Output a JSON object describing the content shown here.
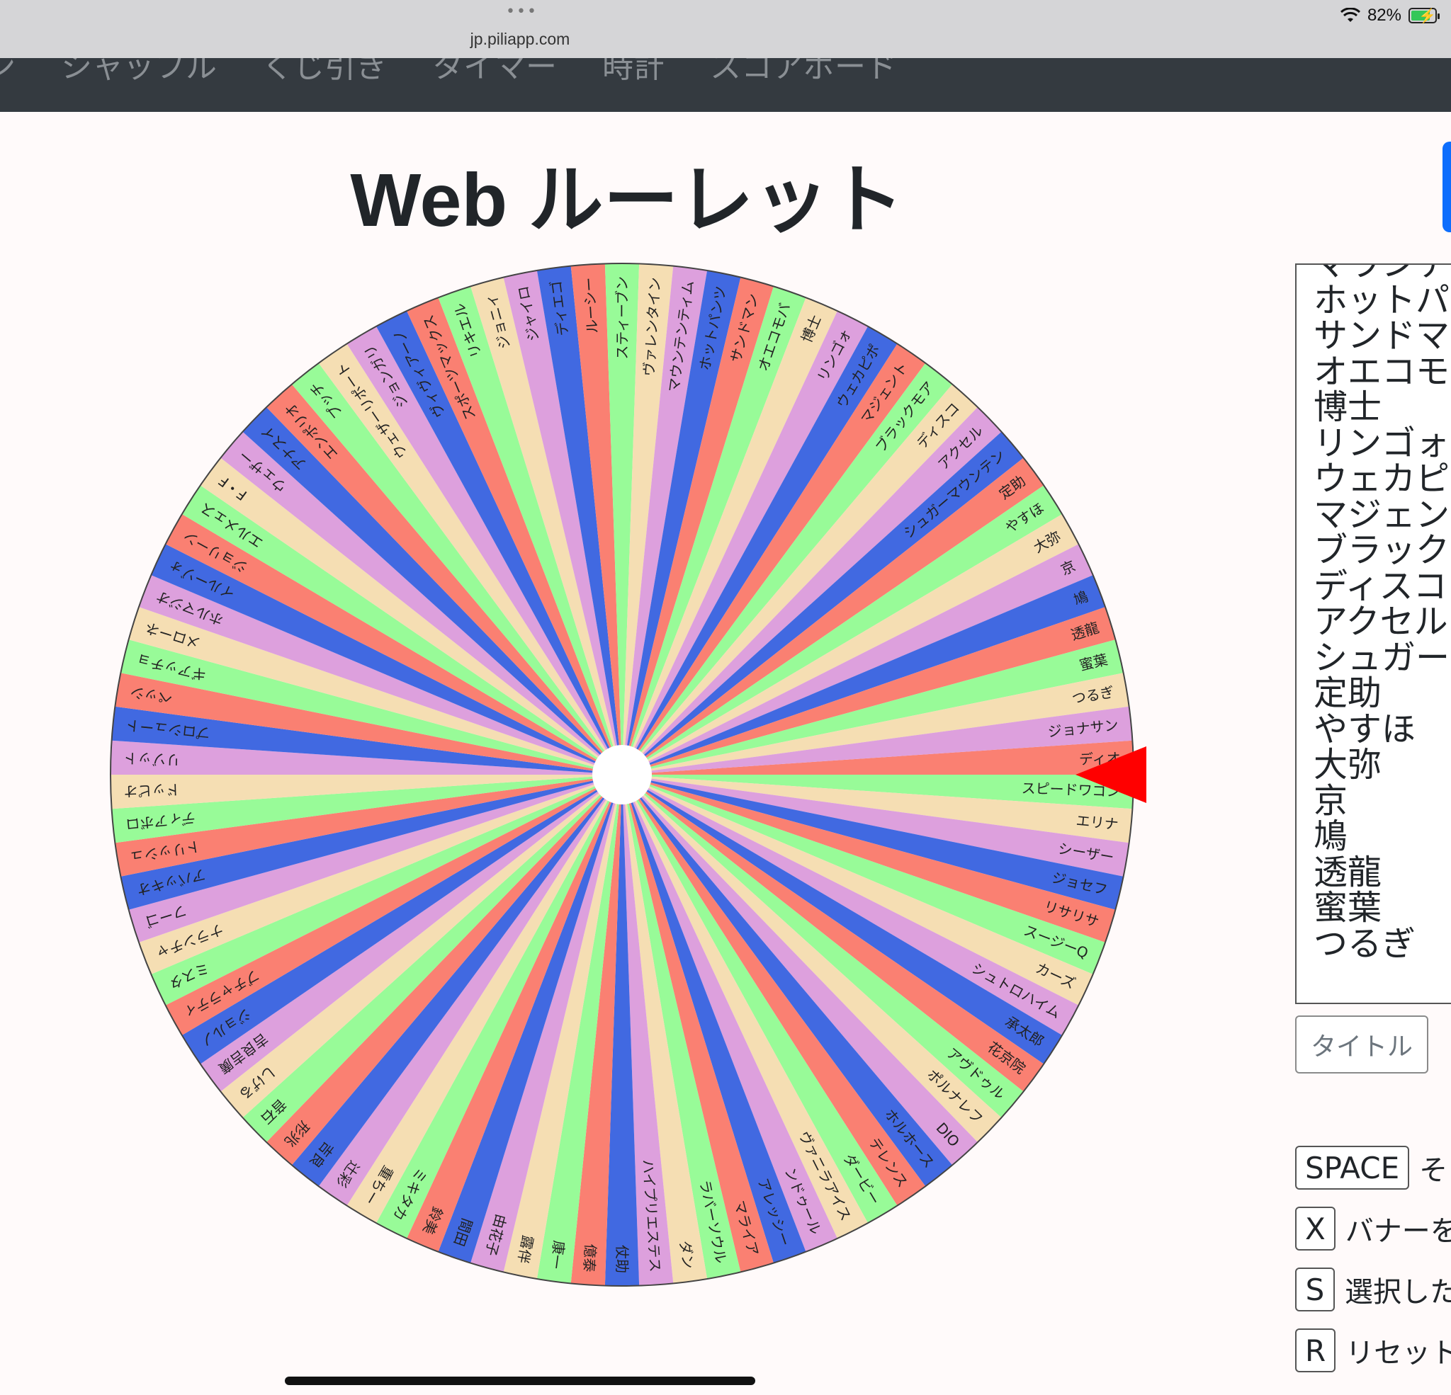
{
  "status_bar": {
    "dots": "•••",
    "url": "jp.piliapp.com",
    "battery_percent": "82%",
    "battery_level": 0.82
  },
  "nav": {
    "items": [
      "ン",
      "シャッフル",
      "くじ引き",
      "タイマー",
      "時計",
      "スコアボード"
    ]
  },
  "title": "Web ルーレット",
  "wheel": {
    "colors": [
      "#fa8072",
      "#98fb98",
      "#f5deb3",
      "#dda0dd",
      "#4169e1"
    ],
    "center_color": "#ffffff",
    "pointer_color": "#ff0000",
    "names": [
      "ディオ",
      "スピードワゴン",
      "エリナ",
      "シーザー",
      "ジョセフ",
      "リサリサ",
      "スージーQ",
      "カーズ",
      "シュトロハイム",
      "承太郎",
      "花京院",
      "アヴドゥル",
      "ポルナレフ",
      "DIO",
      "ホルホース",
      "テレンス",
      "ダービー",
      "ヴァニラアイス",
      "ンドゥール",
      "アレッシー",
      "マライア",
      "ラバーソウル",
      "ダン",
      "ハイプリエステス",
      "仗助",
      "億泰",
      "康一",
      "露伴",
      "由花子",
      "間田",
      "鈴美",
      "ミキタカ",
      "重ちー",
      "辻彩",
      "吉良",
      "形兆",
      "音石",
      "しげる",
      "吉良吉廣",
      "ジョルノ",
      "ブチャラティ",
      "ミスタ",
      "ナランチャ",
      "フーゴ",
      "アバッキオ",
      "トリッシュ",
      "ディアボロ",
      "ドッピオ",
      "リゾット",
      "プロシュート",
      "ペッシ",
      "ギアッチョ",
      "メローネ",
      "ホルマジオ",
      "イルーゾォ",
      "ジョリーン",
      "エルメェス",
      "F・F",
      "ウェザー",
      "アナスイ",
      "エンポリオ",
      "プッチ",
      "ウェザーリポート",
      "ジョンガリ",
      "ヴィヴィアーノ",
      "スポーツマックス",
      "リキエル",
      "ジョニィ",
      "ジャイロ",
      "ディエゴ",
      "ルーシー",
      "スティーブン",
      "ヴァレンタイン",
      "マウンテンティム",
      "ホットパンツ",
      "サンドマン",
      "オエコモバ",
      "博士",
      "リンゴォ",
      "ウェカピポ",
      "マジェント",
      "ブラックモア",
      "ディスコ",
      "アクセル",
      "シュガーマウンテン",
      "定助",
      "やすほ",
      "大弥",
      "京",
      "鳩",
      "透龍",
      "蜜葉",
      "つるぎ",
      "ジョナサン"
    ]
  },
  "list_panel": {
    "items": [
      "マウンテン",
      "ホットパンツ",
      "サンドマン",
      "オエコモバ",
      "博士",
      "リンゴォ",
      "ウェカピポ",
      "マジェント",
      "ブラックモア",
      "ディスコ",
      "アクセル",
      "シュガー",
      "定助",
      "やすほ",
      "大弥",
      "京",
      "鳩",
      "透龍",
      "蜜葉",
      "つるぎ"
    ]
  },
  "title_button": "タイトル",
  "shortcuts": [
    {
      "key": "SPACE",
      "text": "そ"
    },
    {
      "key": "X",
      "text": "バナーを"
    },
    {
      "key": "S",
      "text": "選択した"
    },
    {
      "key": "R",
      "text": "リセット"
    }
  ]
}
